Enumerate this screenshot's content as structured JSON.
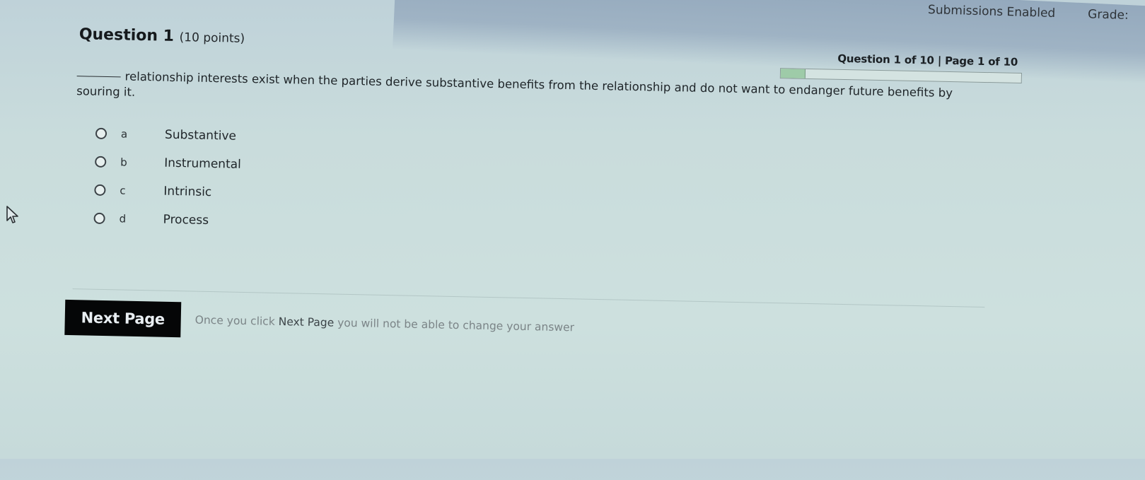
{
  "header": {
    "submissions_status": "Submissions Enabled",
    "grade_label": "Grade:"
  },
  "question": {
    "title": "Question 1",
    "points": "(10 points)",
    "prompt_text": "relationship interests exist when the parties derive substantive benefits from the relationship and do not want to endanger future benefits by souring it.",
    "options": [
      {
        "letter": "a",
        "text": "Substantive",
        "selected": false
      },
      {
        "letter": "b",
        "text": "Instrumental",
        "selected": false
      },
      {
        "letter": "c",
        "text": "Intrinsic",
        "selected": false
      },
      {
        "letter": "d",
        "text": "Process",
        "selected": false
      }
    ]
  },
  "progress": {
    "label": "Question 1 of 10 | Page 1 of 10",
    "current_question": 1,
    "total_questions": 10,
    "fraction_complete": 0.1,
    "fill_color": "#9ecba8"
  },
  "footer": {
    "next_button_label": "Next Page",
    "note_prefix": "Once you click ",
    "note_emphasis": "Next Page",
    "note_suffix": " you will not be able to change your answer"
  },
  "icons": {
    "cursor": "mouse-pointer-icon"
  }
}
